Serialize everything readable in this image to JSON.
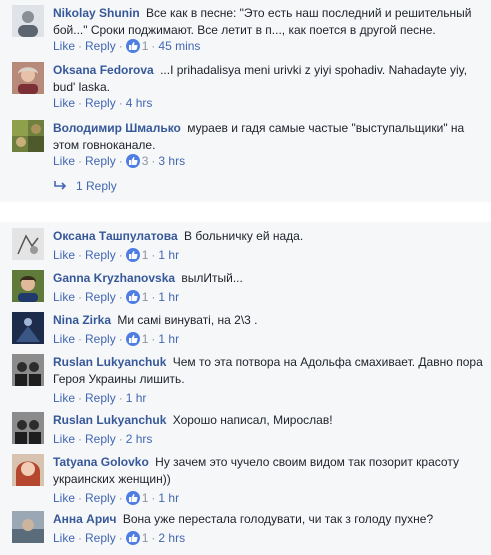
{
  "icons": {
    "like_badge": "thumbs-up-icon",
    "reply_arrow": "reply-arrow-icon"
  },
  "colors": {
    "link": "#4267b2",
    "author": "#365899",
    "muted": "#90949c",
    "panel": "#f6f7f9",
    "like_badge": "#4f7ee3"
  },
  "top_thread": {
    "comments": [
      {
        "author": "Nikolay Shunin",
        "text": "Все как в песне: \"Это есть наш последний и решительный бой...\" Сроки поджимают. Все летит в п..., как поется в другой песне.",
        "like": "Like",
        "reply": "Reply",
        "likes": "1",
        "time": "45 mins"
      },
      {
        "author": "Oksana Fedorova",
        "text": "...I prihadalisya meni urivki z yiyi spohadiv. Nahadayte yiy, bud' laska.",
        "like": "Like",
        "reply": "Reply",
        "time": "4 hrs"
      },
      {
        "author": "Володимир Шмалько",
        "text": "мураев и гадя самые частые \"выступальщики\" на этом говноканале.",
        "like": "Like",
        "reply": "Reply",
        "likes": "3",
        "time": "3 hrs"
      }
    ],
    "replies_link": "1 Reply"
  },
  "bottom_thread": {
    "comments": [
      {
        "author": "Оксана Ташпулатова",
        "text": "В больничку ей нада.",
        "like": "Like",
        "reply": "Reply",
        "likes": "1",
        "time": "1 hr"
      },
      {
        "author": "Ganna Kryzhanovska",
        "text": "вылИтый...",
        "like": "Like",
        "reply": "Reply",
        "likes": "1",
        "time": "1 hr"
      },
      {
        "author": "Nina Zirka",
        "text": "Ми самі винуваті, на 2\\3 .",
        "like": "Like",
        "reply": "Reply",
        "likes": "1",
        "time": "1 hr"
      },
      {
        "author": "Ruslan Lukyanchuk",
        "text": "Чем то эта потвора на Адольфа смахивает. Давно пора Героя Украины лишить.",
        "like": "Like",
        "reply": "Reply",
        "time": "1 hr"
      },
      {
        "author": "Ruslan Lukyanchuk",
        "text": "Хорошо написал, Мирослав!",
        "like": "Like",
        "reply": "Reply",
        "time": "2 hrs"
      },
      {
        "author": "Tatyana Golovko",
        "text": "Ну зачем это чучело своим видом так позорит красоту украинских женщин))",
        "like": "Like",
        "reply": "Reply",
        "likes": "1",
        "time": "1 hr"
      },
      {
        "author": "Анна Арич",
        "text": "Вона уже перестала голодувати, чи так з голоду пухне?",
        "like": "Like",
        "reply": "Reply",
        "likes": "1",
        "time": "2 hrs"
      }
    ]
  }
}
